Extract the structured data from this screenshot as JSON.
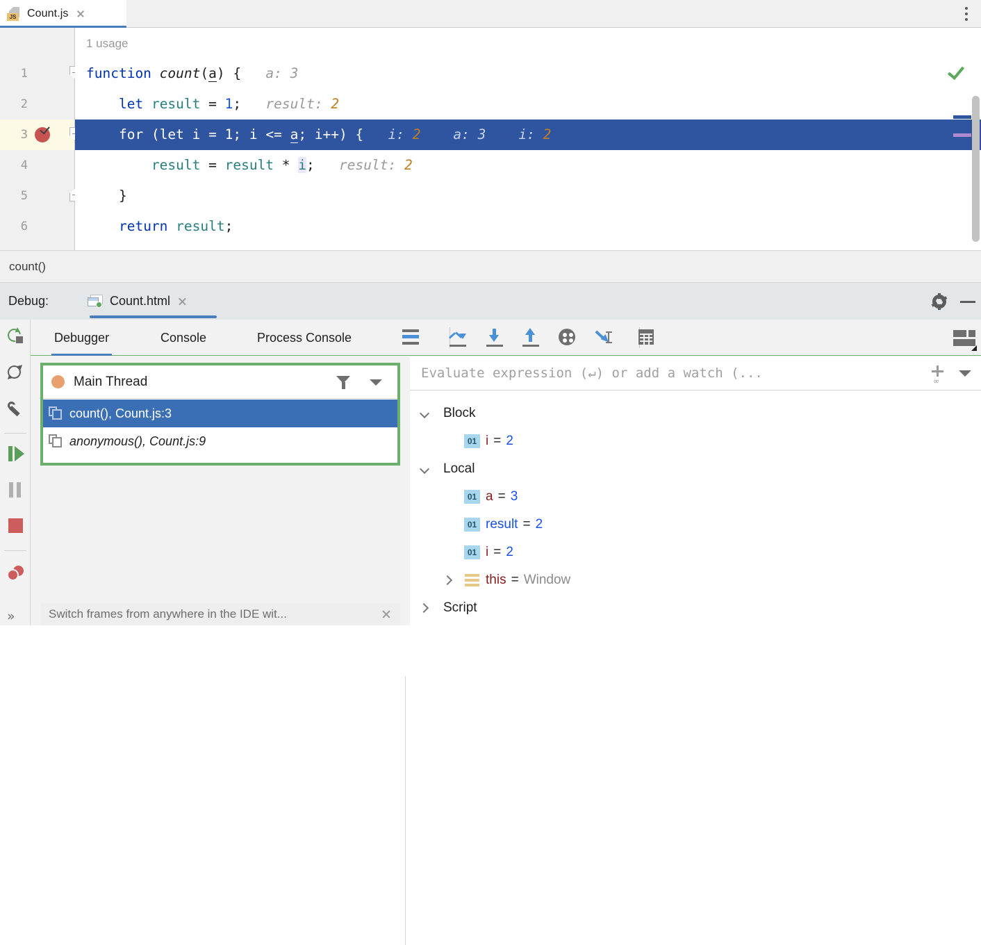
{
  "editor_tab": {
    "filename": "Count.js",
    "file_type_badge": "JS",
    "close_icon": "close-icon",
    "kebab_icon": "more-options-icon"
  },
  "editor": {
    "usage_hint": "1 usage",
    "status_icon": "inspection-ok-checkmark",
    "breadcrumb": "count()",
    "line_numbers": [
      "1",
      "2",
      "3",
      "4",
      "5",
      "6"
    ],
    "breakpoint_line": "3",
    "breakpoint_icon": "breakpoint-verified-icon",
    "lines": [
      {
        "n": "1",
        "tokens": [
          {
            "t": "function",
            "c": "kw"
          },
          {
            "t": " ",
            "c": "plain"
          },
          {
            "t": "count",
            "c": "fn"
          },
          {
            "t": "(",
            "c": "plain"
          },
          {
            "t": "a",
            "c": "par"
          },
          {
            "t": ") {",
            "c": "plain"
          }
        ],
        "inline_name": "a:",
        "inline_value": "3",
        "inline_value_style": "gray"
      },
      {
        "n": "2",
        "tokens": [
          {
            "t": "    ",
            "c": "plain"
          },
          {
            "t": "let",
            "c": "kw"
          },
          {
            "t": " ",
            "c": "plain"
          },
          {
            "t": "result",
            "c": "var"
          },
          {
            "t": " = ",
            "c": "plain"
          },
          {
            "t": "1",
            "c": "num"
          },
          {
            "t": ";",
            "c": "plain"
          }
        ],
        "inline_name": "result:",
        "inline_value": "2",
        "inline_value_style": "orange"
      },
      {
        "n": "3",
        "active": true,
        "tokens": [
          {
            "t": "    ",
            "c": "plain"
          },
          {
            "t": "for",
            "c": "kw"
          },
          {
            "t": " (",
            "c": "plain"
          },
          {
            "t": "let",
            "c": "kw"
          },
          {
            "t": " i = ",
            "c": "plain"
          },
          {
            "t": "1",
            "c": "num"
          },
          {
            "t": "; i <= ",
            "c": "plain"
          },
          {
            "t": "a",
            "c": "par"
          },
          {
            "t": "; i++) {",
            "c": "plain"
          }
        ],
        "inline_groups": [
          {
            "name": "i:",
            "value": "2",
            "style": "orange"
          },
          {
            "name": "a:",
            "value": "3",
            "style": "gray"
          },
          {
            "name": "i:",
            "value": "2",
            "style": "orange"
          }
        ]
      },
      {
        "n": "4",
        "tokens": [
          {
            "t": "        ",
            "c": "plain"
          },
          {
            "t": "result",
            "c": "var"
          },
          {
            "t": " = ",
            "c": "plain"
          },
          {
            "t": "result",
            "c": "var"
          },
          {
            "t": " * ",
            "c": "plain"
          },
          {
            "t": "i",
            "c": "hl-i"
          },
          {
            "t": ";",
            "c": "plain"
          }
        ],
        "inline_name": "result:",
        "inline_value": "2",
        "inline_value_style": "orange"
      },
      {
        "n": "5",
        "tokens": [
          {
            "t": "    }",
            "c": "plain"
          }
        ]
      },
      {
        "n": "6",
        "tokens": [
          {
            "t": "    ",
            "c": "plain"
          },
          {
            "t": "return",
            "c": "kw"
          },
          {
            "t": " ",
            "c": "plain"
          },
          {
            "t": "result",
            "c": "var"
          },
          {
            "t": ";",
            "c": "plain"
          }
        ]
      }
    ]
  },
  "debug_header": {
    "label": "Debug:",
    "session_name": "Count.html",
    "session_icon": "html-file-running-icon",
    "close_icon": "close-icon",
    "settings_icon": "gear-icon",
    "minimize_icon": "minimize-icon"
  },
  "left_rail": [
    {
      "name": "rerun-button",
      "icon": "rerun-icon"
    },
    {
      "name": "restart-button",
      "icon": "restart-icon"
    },
    {
      "name": "edit-configuration-button",
      "icon": "wrench-icon"
    },
    {
      "name": "resume-program-button",
      "icon": "resume-icon"
    },
    {
      "name": "pause-program-button",
      "icon": "pause-icon"
    },
    {
      "name": "stop-button",
      "icon": "stop-icon"
    },
    {
      "name": "view-breakpoints-button",
      "icon": "breakpoints-icon"
    },
    {
      "name": "more-rail-button",
      "icon": "chevron-double-right-icon"
    }
  ],
  "debug_tabs": [
    {
      "label": "Debugger",
      "selected": true
    },
    {
      "label": "Console",
      "selected": false
    },
    {
      "label": "Process Console",
      "selected": false
    }
  ],
  "debug_toolbar": [
    {
      "name": "show-execution-point-button",
      "icon": "execution-point-icon"
    },
    {
      "name": "step-over-button",
      "icon": "step-over-icon"
    },
    {
      "name": "step-into-button",
      "icon": "step-into-icon"
    },
    {
      "name": "step-out-button",
      "icon": "step-out-icon"
    },
    {
      "name": "force-step-into-button",
      "icon": "force-step-into-icon"
    },
    {
      "name": "run-to-cursor-button",
      "icon": "run-to-cursor-icon"
    },
    {
      "name": "evaluate-expression-button",
      "icon": "calculator-icon"
    },
    {
      "name": "layout-settings-button",
      "icon": "layout-icon"
    }
  ],
  "frames_panel": {
    "thread_name": "Main Thread",
    "thread_status_icon": "thread-running-dot",
    "filter_icon": "funnel-icon",
    "dropdown_icon": "chevron-down-icon",
    "highlight_color": "#6aaf6a",
    "frames": [
      {
        "text": "count(), Count.js:3",
        "italic_part": "",
        "selected": true
      },
      {
        "text": "anonymous(), Count.js:9",
        "italic_part": "anonymous",
        "selected": false
      }
    ],
    "tooltip": "Switch frames from anywhere in the IDE wit...",
    "tooltip_close_icon": "close-icon"
  },
  "variables_panel": {
    "eval_placeholder": "Evaluate expression (↵) or add a watch (...",
    "add_watch_icon": "add-watch-icon",
    "dropdown_icon": "chevron-down-icon",
    "tree": [
      {
        "kind": "group",
        "label": "Block",
        "expanded": true,
        "indent": 0
      },
      {
        "kind": "var",
        "badge": "01",
        "name": "i",
        "value": "2",
        "indent": 1,
        "name_style": "red",
        "value_style": "blue"
      },
      {
        "kind": "group",
        "label": "Local",
        "expanded": true,
        "indent": 0
      },
      {
        "kind": "var",
        "badge": "01",
        "name": "a",
        "value": "3",
        "indent": 1,
        "name_style": "red",
        "value_style": "blue"
      },
      {
        "kind": "var",
        "badge": "01",
        "name": "result",
        "value": "2",
        "indent": 1,
        "name_style": "blue",
        "value_style": "blue"
      },
      {
        "kind": "var",
        "badge": "01",
        "name": "i",
        "value": "2",
        "indent": 1,
        "name_style": "red",
        "value_style": "blue"
      },
      {
        "kind": "obj",
        "name": "this",
        "value": "Window",
        "indent": 1,
        "expanded": false,
        "name_style": "red",
        "value_style": "gray"
      },
      {
        "kind": "group",
        "label": "Script",
        "expanded": false,
        "indent": 0
      }
    ]
  },
  "colors": {
    "accent_blue": "#4a7ebb",
    "selection_blue": "#2f54a0",
    "frame_selection": "#3b6fb5",
    "highlight_green": "#6aaf6a",
    "breakpoint_red": "#c75450",
    "keyword_blue": "#0033b3",
    "number_blue": "#1750eb",
    "identifier_teal": "#267f7f",
    "inline_value_orange": "#c08020",
    "var_name_red": "#871b1b"
  }
}
